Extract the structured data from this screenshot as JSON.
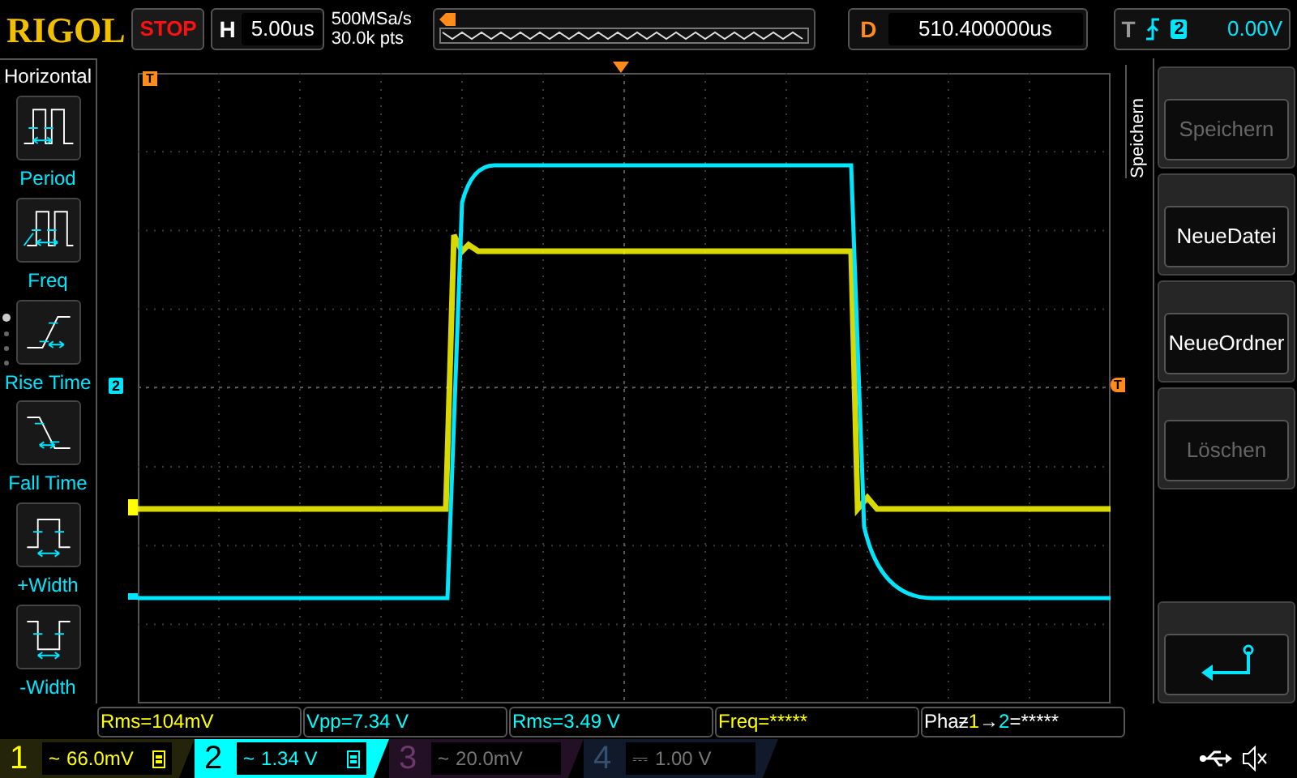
{
  "header": {
    "logo": "RIGOL",
    "run_state": "STOP",
    "timebase": {
      "label": "H",
      "value": "5.00us"
    },
    "sample_rate": "500MSa/s",
    "memory_depth": "30.0k pts",
    "delay": {
      "label": "D",
      "value": "510.400000us"
    },
    "trigger": {
      "label": "T",
      "source": "2",
      "level": "0.00V"
    }
  },
  "left_menu": {
    "title": "Horizontal",
    "items": [
      {
        "kind": "period",
        "label": "Period"
      },
      {
        "kind": "freq",
        "label": "Freq"
      },
      {
        "kind": "rise",
        "label": "Rise Time"
      },
      {
        "kind": "fall",
        "label": "Fall Time"
      },
      {
        "kind": "pwidth",
        "label": "+Width"
      },
      {
        "kind": "nwidth",
        "label": "-Width"
      }
    ]
  },
  "plot": {
    "trigger_position_marker": "T",
    "channel_marker": "2",
    "trigger_level_marker": "T"
  },
  "right_menu": {
    "title": "Speichern",
    "buttons": [
      {
        "kind": "text",
        "label": "Speichern",
        "disabled": true
      },
      {
        "kind": "text",
        "label": "NeueDatei",
        "disabled": false
      },
      {
        "kind": "text",
        "label": "NeueOrdner",
        "disabled": false
      },
      {
        "kind": "text",
        "label": "Löschen",
        "disabled": true
      },
      {
        "kind": "back"
      }
    ]
  },
  "measurements": [
    {
      "parts": [
        {
          "text": "Rms=104mV",
          "color": "#ffff00"
        }
      ]
    },
    {
      "parts": [
        {
          "text": "Vpp=7.34 V",
          "color": "#00ffff"
        }
      ]
    },
    {
      "parts": [
        {
          "text": "Rms=3.49 V",
          "color": "#00ffff"
        }
      ]
    },
    {
      "parts": [
        {
          "text": "Freq=*****",
          "color": "#ffff00"
        }
      ]
    },
    {
      "parts": [
        {
          "text": "Phaƶ",
          "color": "#ffffff"
        },
        {
          "text": "1",
          "color": "#ffff00"
        },
        {
          "text": "→",
          "color": "#ffffff"
        },
        {
          "text": "2",
          "color": "#00ffff"
        },
        {
          "text": "=*****",
          "color": "#ffffff"
        }
      ]
    }
  ],
  "channels": [
    {
      "number": "1",
      "coupling": "~",
      "scale": "66.0mV",
      "on": true,
      "selected": false,
      "color": "#ffff00"
    },
    {
      "number": "2",
      "coupling": "~",
      "scale": "1.34 V",
      "on": true,
      "selected": true,
      "color": "#00ffff"
    },
    {
      "number": "3",
      "coupling": "~",
      "scale": "20.0mV",
      "on": false,
      "selected": false,
      "color": "#6a3a6a"
    },
    {
      "number": "4",
      "coupling": "⎓",
      "scale": "1.00 V",
      "on": false,
      "selected": false,
      "color": "#34506e"
    }
  ]
}
